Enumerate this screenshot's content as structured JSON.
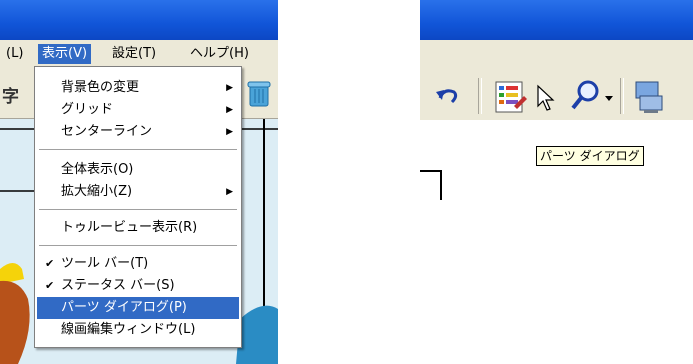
{
  "left_menubar": {
    "items": [
      {
        "label": "(L)"
      },
      {
        "label": "表示(V)"
      },
      {
        "label": "設定(T)"
      },
      {
        "label": "ヘルプ(H)"
      }
    ]
  },
  "toolbar_left": {
    "partial_text": "字"
  },
  "view_menu": {
    "items": [
      {
        "label": "背景色の変更",
        "submenu": true
      },
      {
        "label": "グリッド",
        "submenu": true
      },
      {
        "label": "センターライン",
        "submenu": true
      },
      {
        "label": "全体表示(O)"
      },
      {
        "label": "拡大縮小(Z)",
        "submenu": true
      },
      {
        "label": "トゥルービュー表示(R)"
      },
      {
        "label": "ツール バー(T)",
        "checked": true
      },
      {
        "label": "ステータス バー(S)",
        "checked": true
      },
      {
        "label": "パーツ ダイアログ(P)",
        "highlighted": true
      },
      {
        "label": "線画編集ウィンドウ(L)"
      }
    ],
    "check_glyph": "✔",
    "submenu_glyph": "▶"
  },
  "tooltip": {
    "text": "パーツ ダイアログ"
  },
  "colors": {
    "titlebar": "#1155d8",
    "menubar": "#ece9d8",
    "highlight": "#316ac5",
    "tooltip_bg": "#ffffe1"
  },
  "icons": [
    "undo-icon",
    "parts-dialog-icon",
    "zoom-magnifier-icon",
    "dropdown-arrow-icon",
    "monitor-icon",
    "cursor-icon"
  ]
}
